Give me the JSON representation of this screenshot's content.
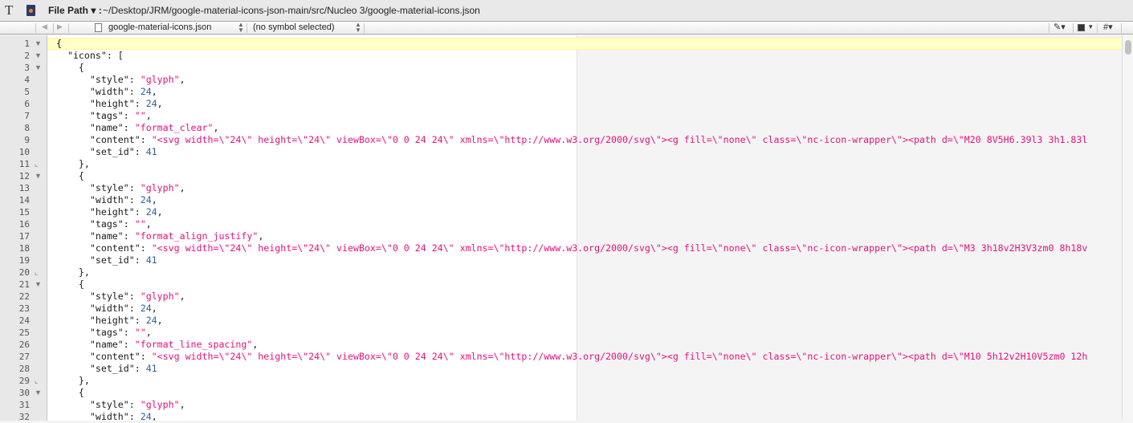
{
  "titlebar": {
    "file_path_label": "File Path ▾ :",
    "file_path": "~/Desktop/JRM/google-material-icons-json-main/src/Nucleo 3/google-material-icons.json",
    "tool_icon": "T"
  },
  "navbar": {
    "file": "google-material-icons.json",
    "symbol": "(no symbol selected)",
    "icons": [
      "back-arrow-icon",
      "forward-arrow-icon",
      "document-icon",
      "marker-icon",
      "bookmark-icon",
      "hash-icon"
    ]
  },
  "colors": {
    "string": "#e8107c",
    "number": "#2d5f9a",
    "current_line": "#ffffc6"
  },
  "editor": {
    "lines": [
      [
        [
          "p",
          "{"
        ]
      ],
      [
        [
          "p",
          "  "
        ],
        [
          "k",
          "\"icons\""
        ],
        [
          "p",
          ": ["
        ]
      ],
      [
        [
          "p",
          "    {"
        ]
      ],
      [
        [
          "p",
          "      "
        ],
        [
          "k",
          "\"style\""
        ],
        [
          "p",
          ": "
        ],
        [
          "s",
          "\"glyph\""
        ],
        [
          "p",
          ","
        ]
      ],
      [
        [
          "p",
          "      "
        ],
        [
          "k",
          "\"width\""
        ],
        [
          "p",
          ": "
        ],
        [
          "n",
          "24"
        ],
        [
          "p",
          ","
        ]
      ],
      [
        [
          "p",
          "      "
        ],
        [
          "k",
          "\"height\""
        ],
        [
          "p",
          ": "
        ],
        [
          "n",
          "24"
        ],
        [
          "p",
          ","
        ]
      ],
      [
        [
          "p",
          "      "
        ],
        [
          "k",
          "\"tags\""
        ],
        [
          "p",
          ": "
        ],
        [
          "s",
          "\"\""
        ],
        [
          "p",
          ","
        ]
      ],
      [
        [
          "p",
          "      "
        ],
        [
          "k",
          "\"name\""
        ],
        [
          "p",
          ": "
        ],
        [
          "s",
          "\"format_clear\""
        ],
        [
          "p",
          ","
        ]
      ],
      [
        [
          "p",
          "      "
        ],
        [
          "k",
          "\"content\""
        ],
        [
          "p",
          ": "
        ],
        [
          "s",
          "\"<svg width=\\\"24\\\" height=\\\"24\\\" viewBox=\\\"0 0 24 24\\\" xmlns=\\\"http://www.w3.org/2000/svg\\\"><g fill=\\\"none\\\" class=\\\"nc-icon-wrapper\\\"><path d=\\\"M20 8V5H6.39l3 3h1.83l"
        ]
      ],
      [
        [
          "p",
          "      "
        ],
        [
          "k",
          "\"set_id\""
        ],
        [
          "p",
          ": "
        ],
        [
          "n",
          "41"
        ]
      ],
      [
        [
          "p",
          "    },"
        ]
      ],
      [
        [
          "p",
          "    {"
        ]
      ],
      [
        [
          "p",
          "      "
        ],
        [
          "k",
          "\"style\""
        ],
        [
          "p",
          ": "
        ],
        [
          "s",
          "\"glyph\""
        ],
        [
          "p",
          ","
        ]
      ],
      [
        [
          "p",
          "      "
        ],
        [
          "k",
          "\"width\""
        ],
        [
          "p",
          ": "
        ],
        [
          "n",
          "24"
        ],
        [
          "p",
          ","
        ]
      ],
      [
        [
          "p",
          "      "
        ],
        [
          "k",
          "\"height\""
        ],
        [
          "p",
          ": "
        ],
        [
          "n",
          "24"
        ],
        [
          "p",
          ","
        ]
      ],
      [
        [
          "p",
          "      "
        ],
        [
          "k",
          "\"tags\""
        ],
        [
          "p",
          ": "
        ],
        [
          "s",
          "\"\""
        ],
        [
          "p",
          ","
        ]
      ],
      [
        [
          "p",
          "      "
        ],
        [
          "k",
          "\"name\""
        ],
        [
          "p",
          ": "
        ],
        [
          "s",
          "\"format_align_justify\""
        ],
        [
          "p",
          ","
        ]
      ],
      [
        [
          "p",
          "      "
        ],
        [
          "k",
          "\"content\""
        ],
        [
          "p",
          ": "
        ],
        [
          "s",
          "\"<svg width=\\\"24\\\" height=\\\"24\\\" viewBox=\\\"0 0 24 24\\\" xmlns=\\\"http://www.w3.org/2000/svg\\\"><g fill=\\\"none\\\" class=\\\"nc-icon-wrapper\\\"><path d=\\\"M3 3h18v2H3V3zm0 8h18v"
        ]
      ],
      [
        [
          "p",
          "      "
        ],
        [
          "k",
          "\"set_id\""
        ],
        [
          "p",
          ": "
        ],
        [
          "n",
          "41"
        ]
      ],
      [
        [
          "p",
          "    },"
        ]
      ],
      [
        [
          "p",
          "    {"
        ]
      ],
      [
        [
          "p",
          "      "
        ],
        [
          "k",
          "\"style\""
        ],
        [
          "p",
          ": "
        ],
        [
          "s",
          "\"glyph\""
        ],
        [
          "p",
          ","
        ]
      ],
      [
        [
          "p",
          "      "
        ],
        [
          "k",
          "\"width\""
        ],
        [
          "p",
          ": "
        ],
        [
          "n",
          "24"
        ],
        [
          "p",
          ","
        ]
      ],
      [
        [
          "p",
          "      "
        ],
        [
          "k",
          "\"height\""
        ],
        [
          "p",
          ": "
        ],
        [
          "n",
          "24"
        ],
        [
          "p",
          ","
        ]
      ],
      [
        [
          "p",
          "      "
        ],
        [
          "k",
          "\"tags\""
        ],
        [
          "p",
          ": "
        ],
        [
          "s",
          "\"\""
        ],
        [
          "p",
          ","
        ]
      ],
      [
        [
          "p",
          "      "
        ],
        [
          "k",
          "\"name\""
        ],
        [
          "p",
          ": "
        ],
        [
          "s",
          "\"format_line_spacing\""
        ],
        [
          "p",
          ","
        ]
      ],
      [
        [
          "p",
          "      "
        ],
        [
          "k",
          "\"content\""
        ],
        [
          "p",
          ": "
        ],
        [
          "s",
          "\"<svg width=\\\"24\\\" height=\\\"24\\\" viewBox=\\\"0 0 24 24\\\" xmlns=\\\"http://www.w3.org/2000/svg\\\"><g fill=\\\"none\\\" class=\\\"nc-icon-wrapper\\\"><path d=\\\"M10 5h12v2H10V5zm0 12h"
        ]
      ],
      [
        [
          "p",
          "      "
        ],
        [
          "k",
          "\"set_id\""
        ],
        [
          "p",
          ": "
        ],
        [
          "n",
          "41"
        ]
      ],
      [
        [
          "p",
          "    },"
        ]
      ],
      [
        [
          "p",
          "    {"
        ]
      ],
      [
        [
          "p",
          "      "
        ],
        [
          "k",
          "\"style\""
        ],
        [
          "p",
          ": "
        ],
        [
          "s",
          "\"glyph\""
        ],
        [
          "p",
          ","
        ]
      ],
      [
        [
          "p",
          "      "
        ],
        [
          "k",
          "\"width\""
        ],
        [
          "p",
          ": "
        ],
        [
          "n",
          "24"
        ],
        [
          "p",
          ","
        ]
      ]
    ],
    "line_numbers": [
      "1",
      "2",
      "3",
      "4",
      "5",
      "6",
      "7",
      "8",
      "9",
      "10",
      "11",
      "12",
      "13",
      "14",
      "15",
      "16",
      "17",
      "18",
      "19",
      "20",
      "21",
      "22",
      "23",
      "24",
      "25",
      "26",
      "27",
      "28",
      "29",
      "30",
      "31",
      "32"
    ],
    "fold_open": [
      1,
      2,
      3,
      12,
      21,
      30
    ],
    "fold_close": [
      11,
      20,
      29
    ]
  }
}
